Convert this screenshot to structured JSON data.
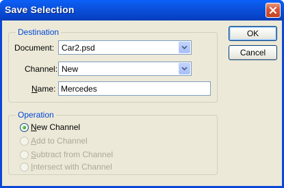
{
  "window": {
    "title": "Save Selection"
  },
  "destination": {
    "legend": "Destination",
    "document_label": "Document:",
    "document_value": "Car2.psd",
    "channel_label": "Channel:",
    "channel_value": "New",
    "name_label_prefix": "",
    "name_label_underline": "N",
    "name_label_rest": "ame:",
    "name_value": "Mercedes"
  },
  "operation": {
    "legend": "Operation",
    "options": [
      {
        "label_underline": "N",
        "label_rest": "ew Channel",
        "checked": true,
        "disabled": false
      },
      {
        "label_underline": "A",
        "label_rest": "dd to Channel",
        "checked": false,
        "disabled": true
      },
      {
        "label_underline": "S",
        "label_rest": "ubtract from Channel",
        "checked": false,
        "disabled": true
      },
      {
        "label_underline": "I",
        "label_rest": "ntersect with Channel",
        "checked": false,
        "disabled": true
      }
    ]
  },
  "buttons": {
    "ok": "OK",
    "cancel": "Cancel"
  },
  "colors": {
    "titlebar": "#0a4ed8",
    "client": "#ece9d8",
    "legend": "#0046d5",
    "disabled_text": "#aca899"
  }
}
